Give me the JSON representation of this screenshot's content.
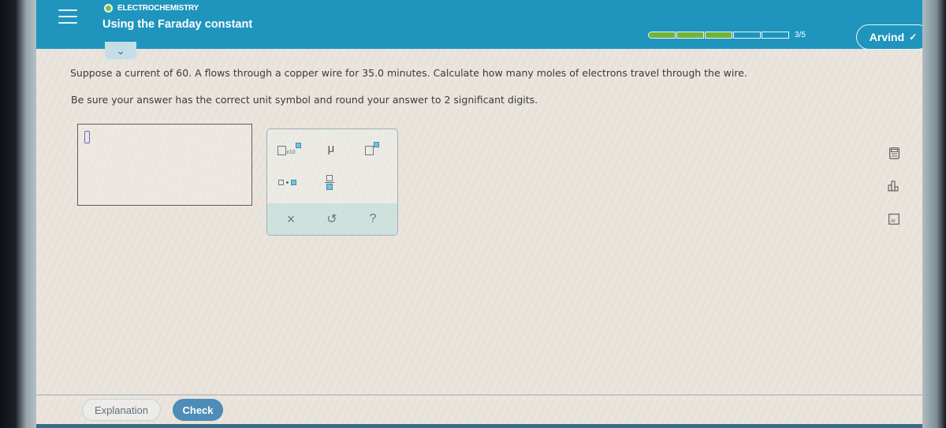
{
  "header": {
    "topic": "ELECTROCHEMISTRY",
    "lesson_title": "Using the Faraday constant",
    "progress": {
      "completed": 3,
      "total": 5,
      "label": "3/5"
    },
    "user_name": "Arvind",
    "colors": {
      "bar": "#1f95bd",
      "progress_fill": "#6fb43c",
      "topic_dot": "#7fbf3a"
    }
  },
  "question": {
    "text": "Suppose a current of 60. A flows through a copper wire for 35.0 minutes. Calculate how many moles of electrons travel through the wire.",
    "instruction": "Be sure your answer has the correct unit symbol and round your answer to 2 significant digits."
  },
  "answer": {
    "value": ""
  },
  "palette": {
    "x10_label": "x10",
    "mu_label": "μ",
    "clear_symbol": "×",
    "undo_symbol": "↺",
    "help_symbol": "?"
  },
  "side_tools": [
    {
      "name": "calculator"
    },
    {
      "name": "data-chart"
    },
    {
      "name": "periodic-table",
      "label": "Ar"
    }
  ],
  "footer": {
    "explanation_label": "Explanation",
    "check_label": "Check",
    "check_color": "#4d8db7"
  }
}
